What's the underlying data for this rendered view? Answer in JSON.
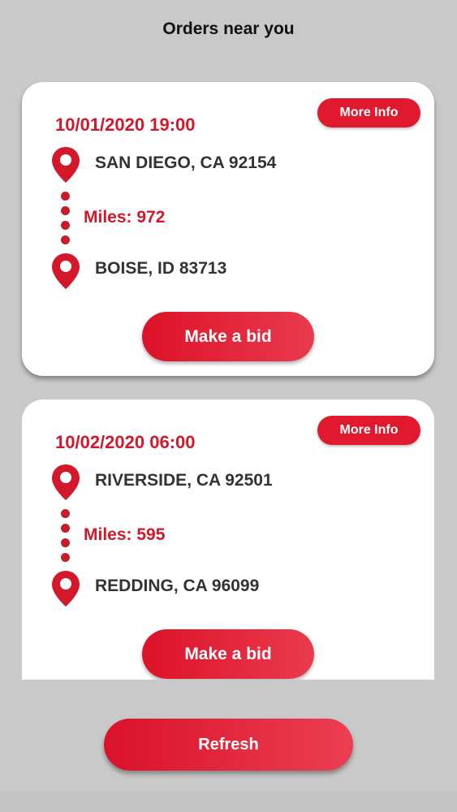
{
  "header": {
    "title": "Orders near you"
  },
  "orders": [
    {
      "date": "10/01/2020 19:00",
      "more_info_label": "More Info",
      "origin": "SAN DIEGO, CA 92154",
      "miles": "Miles: 972",
      "destination": "BOISE, ID 83713",
      "bid_label": "Make a bid"
    },
    {
      "date": "10/02/2020 06:00",
      "more_info_label": "More Info",
      "origin": "RIVERSIDE, CA 92501",
      "miles": "Miles: 595",
      "destination": "REDDING, CA 96099",
      "bid_label": "Make a bid"
    }
  ],
  "footer": {
    "refresh_label": "Refresh"
  },
  "colors": {
    "accent": "#e0192f",
    "date_text": "#d01a2c",
    "background": "#c9c9c9"
  },
  "icons": {
    "pin": "location-pin-icon"
  }
}
